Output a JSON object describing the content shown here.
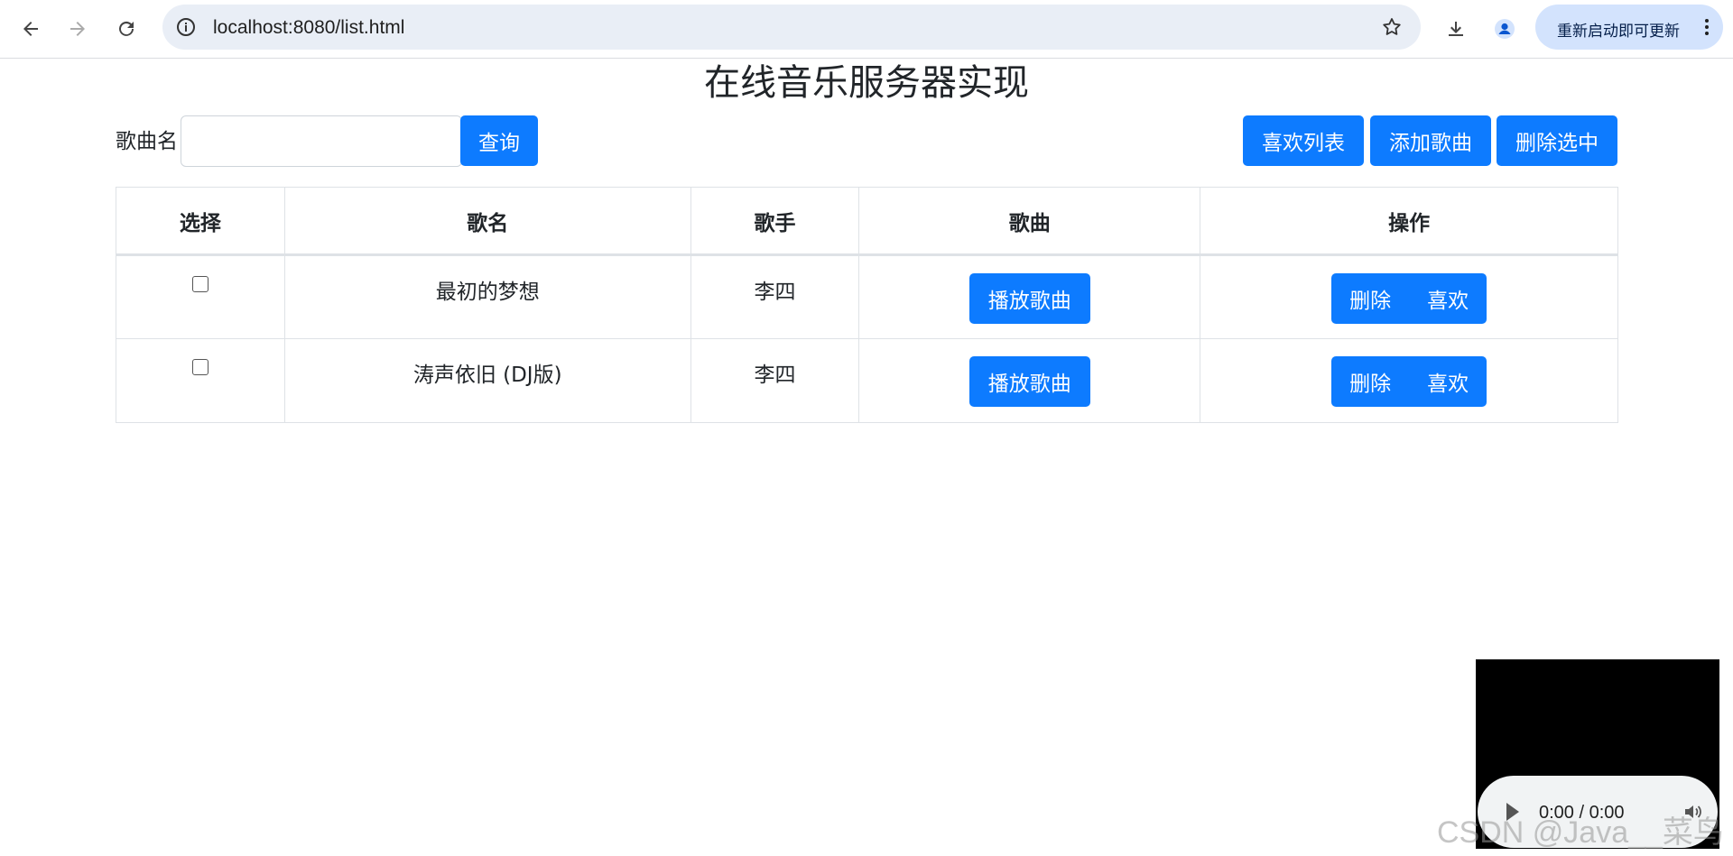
{
  "browser": {
    "url": "localhost:8080/list.html",
    "update_label": "重新启动即可更新"
  },
  "page": {
    "title": "在线音乐服务器实现",
    "search_label": "歌曲名",
    "search_value": "",
    "search_button": "查询",
    "fav_list_button": "喜欢列表",
    "add_song_button": "添加歌曲",
    "delete_selected_button": "删除选中"
  },
  "table": {
    "headers": [
      "选择",
      "歌名",
      "歌手",
      "歌曲",
      "操作"
    ],
    "rows": [
      {
        "name": "最初的梦想",
        "singer": "李四",
        "play": "播放歌曲",
        "delete": "删除",
        "like": "喜欢"
      },
      {
        "name": "涛声依旧 (DJ版)",
        "singer": "李四",
        "play": "播放歌曲",
        "delete": "删除",
        "like": "喜欢"
      }
    ]
  },
  "player": {
    "time": "0:00 / 0:00"
  },
  "watermark": "CSDN @Java__菜鸟"
}
